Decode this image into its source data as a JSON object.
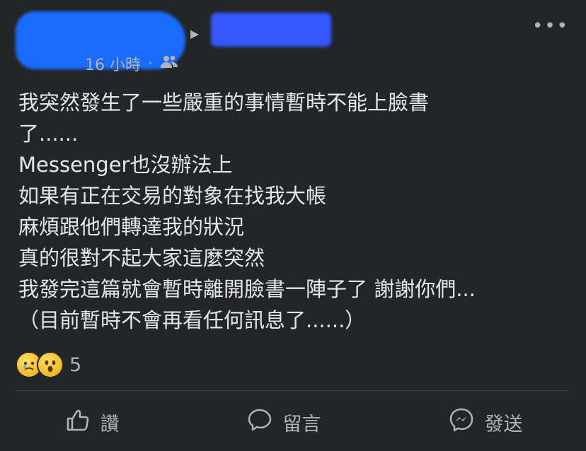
{
  "post": {
    "time": "16 小時",
    "separator": "·",
    "audience_icon": "friends-icon",
    "more": "•••",
    "lines": [
      "我突然發生了一些嚴重的事情暫時不能上臉書",
      "了......",
      "Messenger也沒辦法上",
      "如果有正在交易的對象在找我大帳",
      "麻煩跟他們轉達我的狀況",
      "真的很對不起大家這麼突然",
      "我發完這篇就會暫時離開臉書一陣子了 謝謝你們...",
      "（目前暫時不會再看任何訊息了......）"
    ]
  },
  "reactions": {
    "types": [
      "sad",
      "wow"
    ],
    "count": "5"
  },
  "actions": {
    "like": "讚",
    "comment": "留言",
    "share": "發送"
  }
}
